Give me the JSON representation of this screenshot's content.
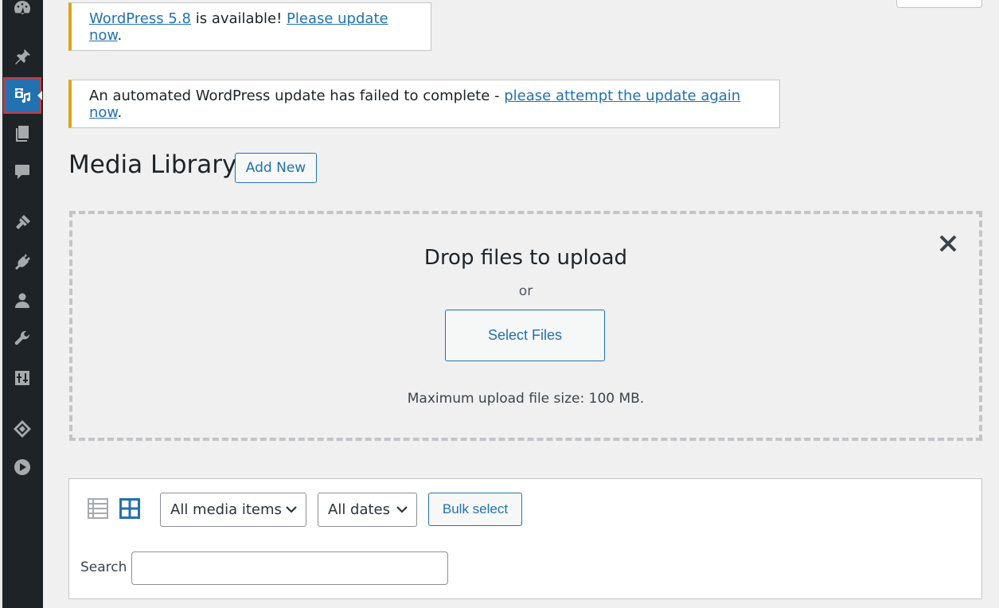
{
  "notices": {
    "update": {
      "version_link": "WordPress 5.8",
      "middle_text": " is available! ",
      "update_link": "Please update now",
      "end_text": "."
    },
    "failed": {
      "text": "An automated WordPress update has failed to complete - ",
      "link": "please attempt the update again now",
      "end_text": "."
    }
  },
  "page": {
    "title": "Media Library",
    "add_new_label": "Add New"
  },
  "upload": {
    "title": "Drop files to upload",
    "or_text": "or",
    "select_files_label": "Select Files",
    "max_size_text": "Maximum upload file size: 100 MB."
  },
  "toolbar": {
    "media_filter": "All media items",
    "date_filter": "All dates",
    "bulk_select_label": "Bulk select",
    "search_label": "Search",
    "search_value": ""
  },
  "sidebar": {
    "icons": [
      "dashboard-icon",
      "posts-pin-icon",
      "media-icon",
      "pages-icon",
      "comments-icon",
      "appearance-brush-icon",
      "plugins-icon",
      "users-icon",
      "tools-wrench-icon",
      "settings-sliders-icon",
      "diamond-plugin-icon",
      "play-circle-icon"
    ],
    "active": "media-icon"
  },
  "colors": {
    "sidebar_bg": "#1d2327",
    "accent": "#2271b1",
    "notice_warning": "#dba617",
    "active_highlight": "#d63638"
  }
}
